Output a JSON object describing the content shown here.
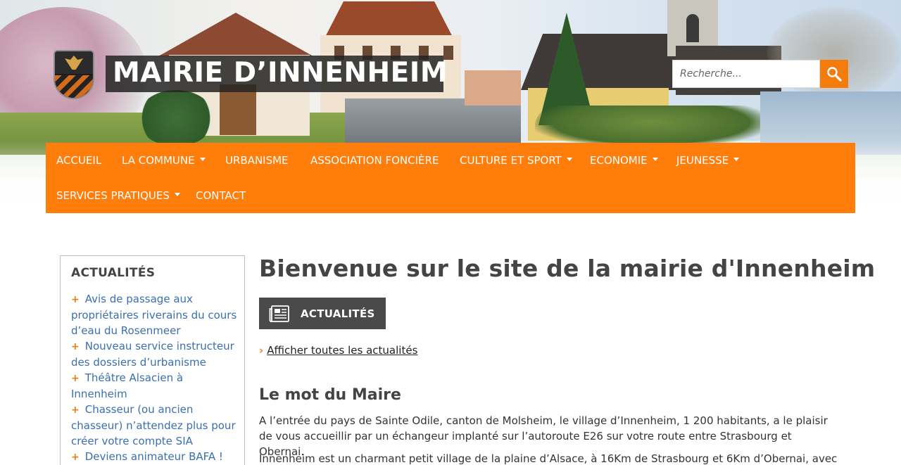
{
  "header": {
    "site_title": "MAIRIE D’INNENHEIM",
    "logo_icon": "coat-of-arms-icon",
    "search": {
      "placeholder": "Recherche...",
      "icon": "search-icon"
    }
  },
  "colors": {
    "accent": "#ff7d0a",
    "link": "#3a6fb0",
    "dark_button": "#4a4a4a"
  },
  "nav": {
    "items": [
      {
        "label": "ACCUEIL",
        "dropdown": false
      },
      {
        "label": "LA COMMUNE",
        "dropdown": true
      },
      {
        "label": "URBANISME",
        "dropdown": false
      },
      {
        "label": "ASSOCIATION FONCIÈRE",
        "dropdown": false
      },
      {
        "label": "CULTURE ET SPORT",
        "dropdown": true
      },
      {
        "label": "ECONOMIE",
        "dropdown": true
      },
      {
        "label": "JEUNESSE",
        "dropdown": true
      },
      {
        "label": "SERVICES PRATIQUES",
        "dropdown": true
      },
      {
        "label": "CONTACT",
        "dropdown": false
      }
    ]
  },
  "sidebar": {
    "title": "ACTUALITÉS",
    "items": [
      {
        "marker": "+",
        "label": "Avis de passage aux propriétaires riverains du cours d’eau du Rosenmeer"
      },
      {
        "marker": "+",
        "label": "Nouveau service instructeur des dossiers d’urbanisme"
      },
      {
        "marker": "+",
        "label": "Théâtre Alsacien à Innenheim"
      },
      {
        "marker": "+",
        "label": "Chasseur (ou ancien chasseur) n’attendez plus pour créer votre compte SIA"
      },
      {
        "marker": "+",
        "label": "Deviens animateur BAFA !"
      }
    ]
  },
  "main": {
    "title": "Bienvenue sur le site de la mairie d'Innenheim",
    "news_button": {
      "label": "ACTUALITÉS",
      "icon": "newspaper-icon"
    },
    "all_news": {
      "chevron": "›",
      "label": "Afficher toutes les actualités"
    },
    "maire": {
      "title": "Le mot du Maire",
      "paragraphs": [
        "A l’entrée du pays de Sainte Odile, canton de Molsheim, le village d’Innenheim, 1 200 habitants, a le plaisir de vous accueillir par un échangeur implanté sur l’autoroute E26 sur votre route entre Strasbourg et Obernai.",
        "Innenheim est un charmant petit village de la plaine d’Alsace, à 16Km de Strasbourg et 6Km d’Obernai, avec"
      ]
    }
  }
}
